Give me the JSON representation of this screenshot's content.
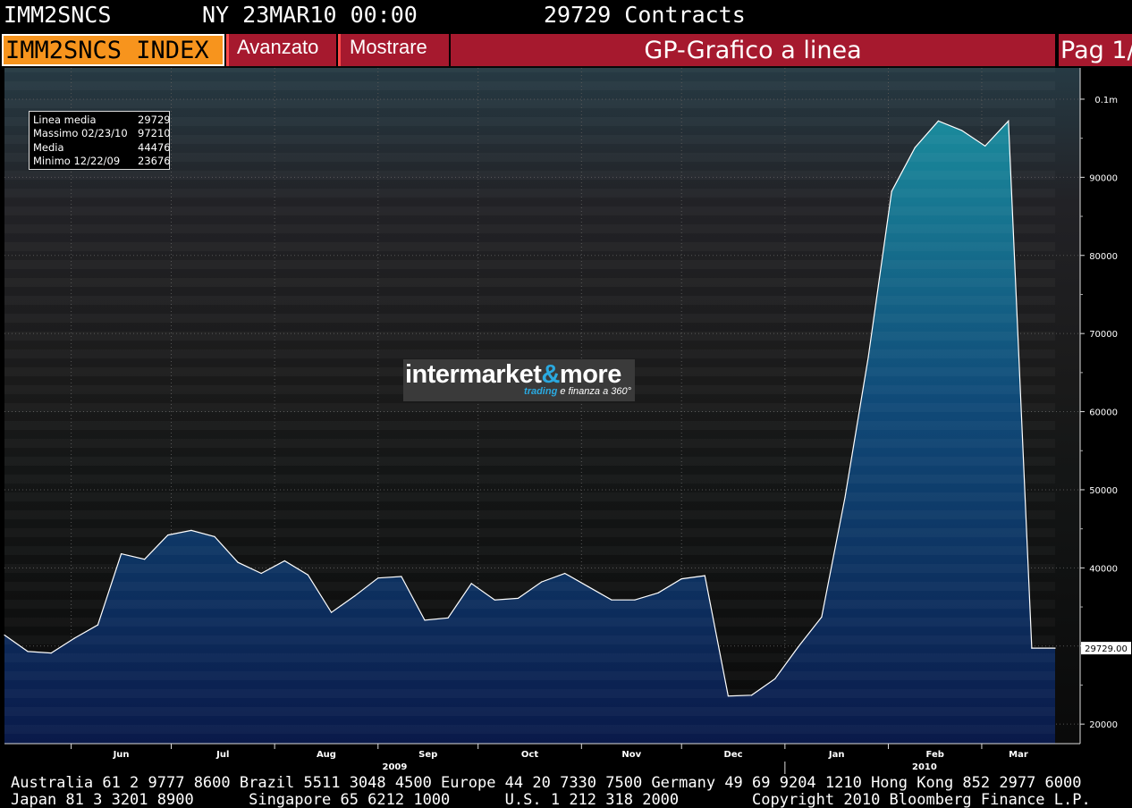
{
  "header": {
    "ticker": "IMM2SNCS",
    "datetime": "NY 23MAR10 00:00",
    "contracts": "29729 Contracts"
  },
  "menu": {
    "index": "IMM2SNCS INDEX",
    "advanced": "Avanzato",
    "show": "Mostrare",
    "title": "GP-Grafico a linea",
    "page": "Pag 1/"
  },
  "legend": {
    "rows": [
      {
        "label": "Linea media",
        "value": "29729"
      },
      {
        "label": "Massimo 02/23/10",
        "value": "97210"
      },
      {
        "label": "Media",
        "value": "44476"
      },
      {
        "label": "Minimo 12/22/09",
        "value": "23676"
      }
    ]
  },
  "watermark": {
    "brand_left": "intermarket",
    "brand_amp": "&",
    "brand_right": "more",
    "tagline_a": "trading",
    "tagline_b": " e finanza a 360°"
  },
  "footer": {
    "line1": "Australia 61 2 9777 8600 Brazil 5511 3048 4500 Europe 44 20 7330 7500 Germany 49 69 9204 1210 Hong Kong 852 2977 6000",
    "line2": "Japan 81 3 3201 8900      Singapore 65 6212 1000      U.S. 1 212 318 2000        Copyright 2010 Bloomberg Finance L.P."
  },
  "colors": {
    "menu_red": "#a6192e",
    "index_orange": "#f7941d",
    "line": "#ffffff",
    "fill_top": "#1a8a9c",
    "fill_bottom": "#0a1a4a"
  },
  "chart_data": {
    "type": "area",
    "ylim": [
      17500,
      104000
    ],
    "yticks": [
      20000,
      30000,
      40000,
      50000,
      60000,
      70000,
      80000,
      90000,
      100000
    ],
    "ytick_labels": [
      "20000",
      "",
      "40000",
      "50000",
      "60000",
      "70000",
      "80000",
      "90000",
      "0.1m"
    ],
    "last_value_label": "29729.00",
    "x_labels": [
      "Jun",
      "Jul",
      "Aug",
      "Sep",
      "Oct",
      "Nov",
      "Dec",
      "Jan",
      "Feb",
      "Mar"
    ],
    "year_labels": [
      "2009",
      "2010"
    ],
    "x": [
      "2009-05-12",
      "2009-05-19",
      "2009-05-26",
      "2009-06-02",
      "2009-06-09",
      "2009-06-16",
      "2009-06-23",
      "2009-06-30",
      "2009-07-07",
      "2009-07-14",
      "2009-07-21",
      "2009-07-28",
      "2009-08-04",
      "2009-08-11",
      "2009-08-18",
      "2009-08-25",
      "2009-09-01",
      "2009-09-08",
      "2009-09-15",
      "2009-09-22",
      "2009-09-29",
      "2009-10-06",
      "2009-10-13",
      "2009-10-20",
      "2009-10-27",
      "2009-11-03",
      "2009-11-10",
      "2009-11-17",
      "2009-11-24",
      "2009-12-01",
      "2009-12-08",
      "2009-12-15",
      "2009-12-22",
      "2009-12-29",
      "2010-01-05",
      "2010-01-12",
      "2010-01-19",
      "2010-01-26",
      "2010-02-02",
      "2010-02-09",
      "2010-02-16",
      "2010-02-23",
      "2010-03-02",
      "2010-03-09",
      "2010-03-16",
      "2010-03-23"
    ],
    "values": [
      31400,
      29300,
      29100,
      31000,
      32700,
      41800,
      41100,
      44200,
      44800,
      44000,
      40700,
      39300,
      40900,
      39100,
      34300,
      36400,
      38700,
      38900,
      33300,
      33600,
      38000,
      35900,
      36100,
      38200,
      39300,
      37600,
      35900,
      35900,
      36800,
      38600,
      39000,
      23600,
      23700,
      25800,
      29900,
      33700,
      49000,
      67000,
      88200,
      93800,
      97210,
      96000,
      94000,
      97210,
      29729,
      29729
    ]
  }
}
